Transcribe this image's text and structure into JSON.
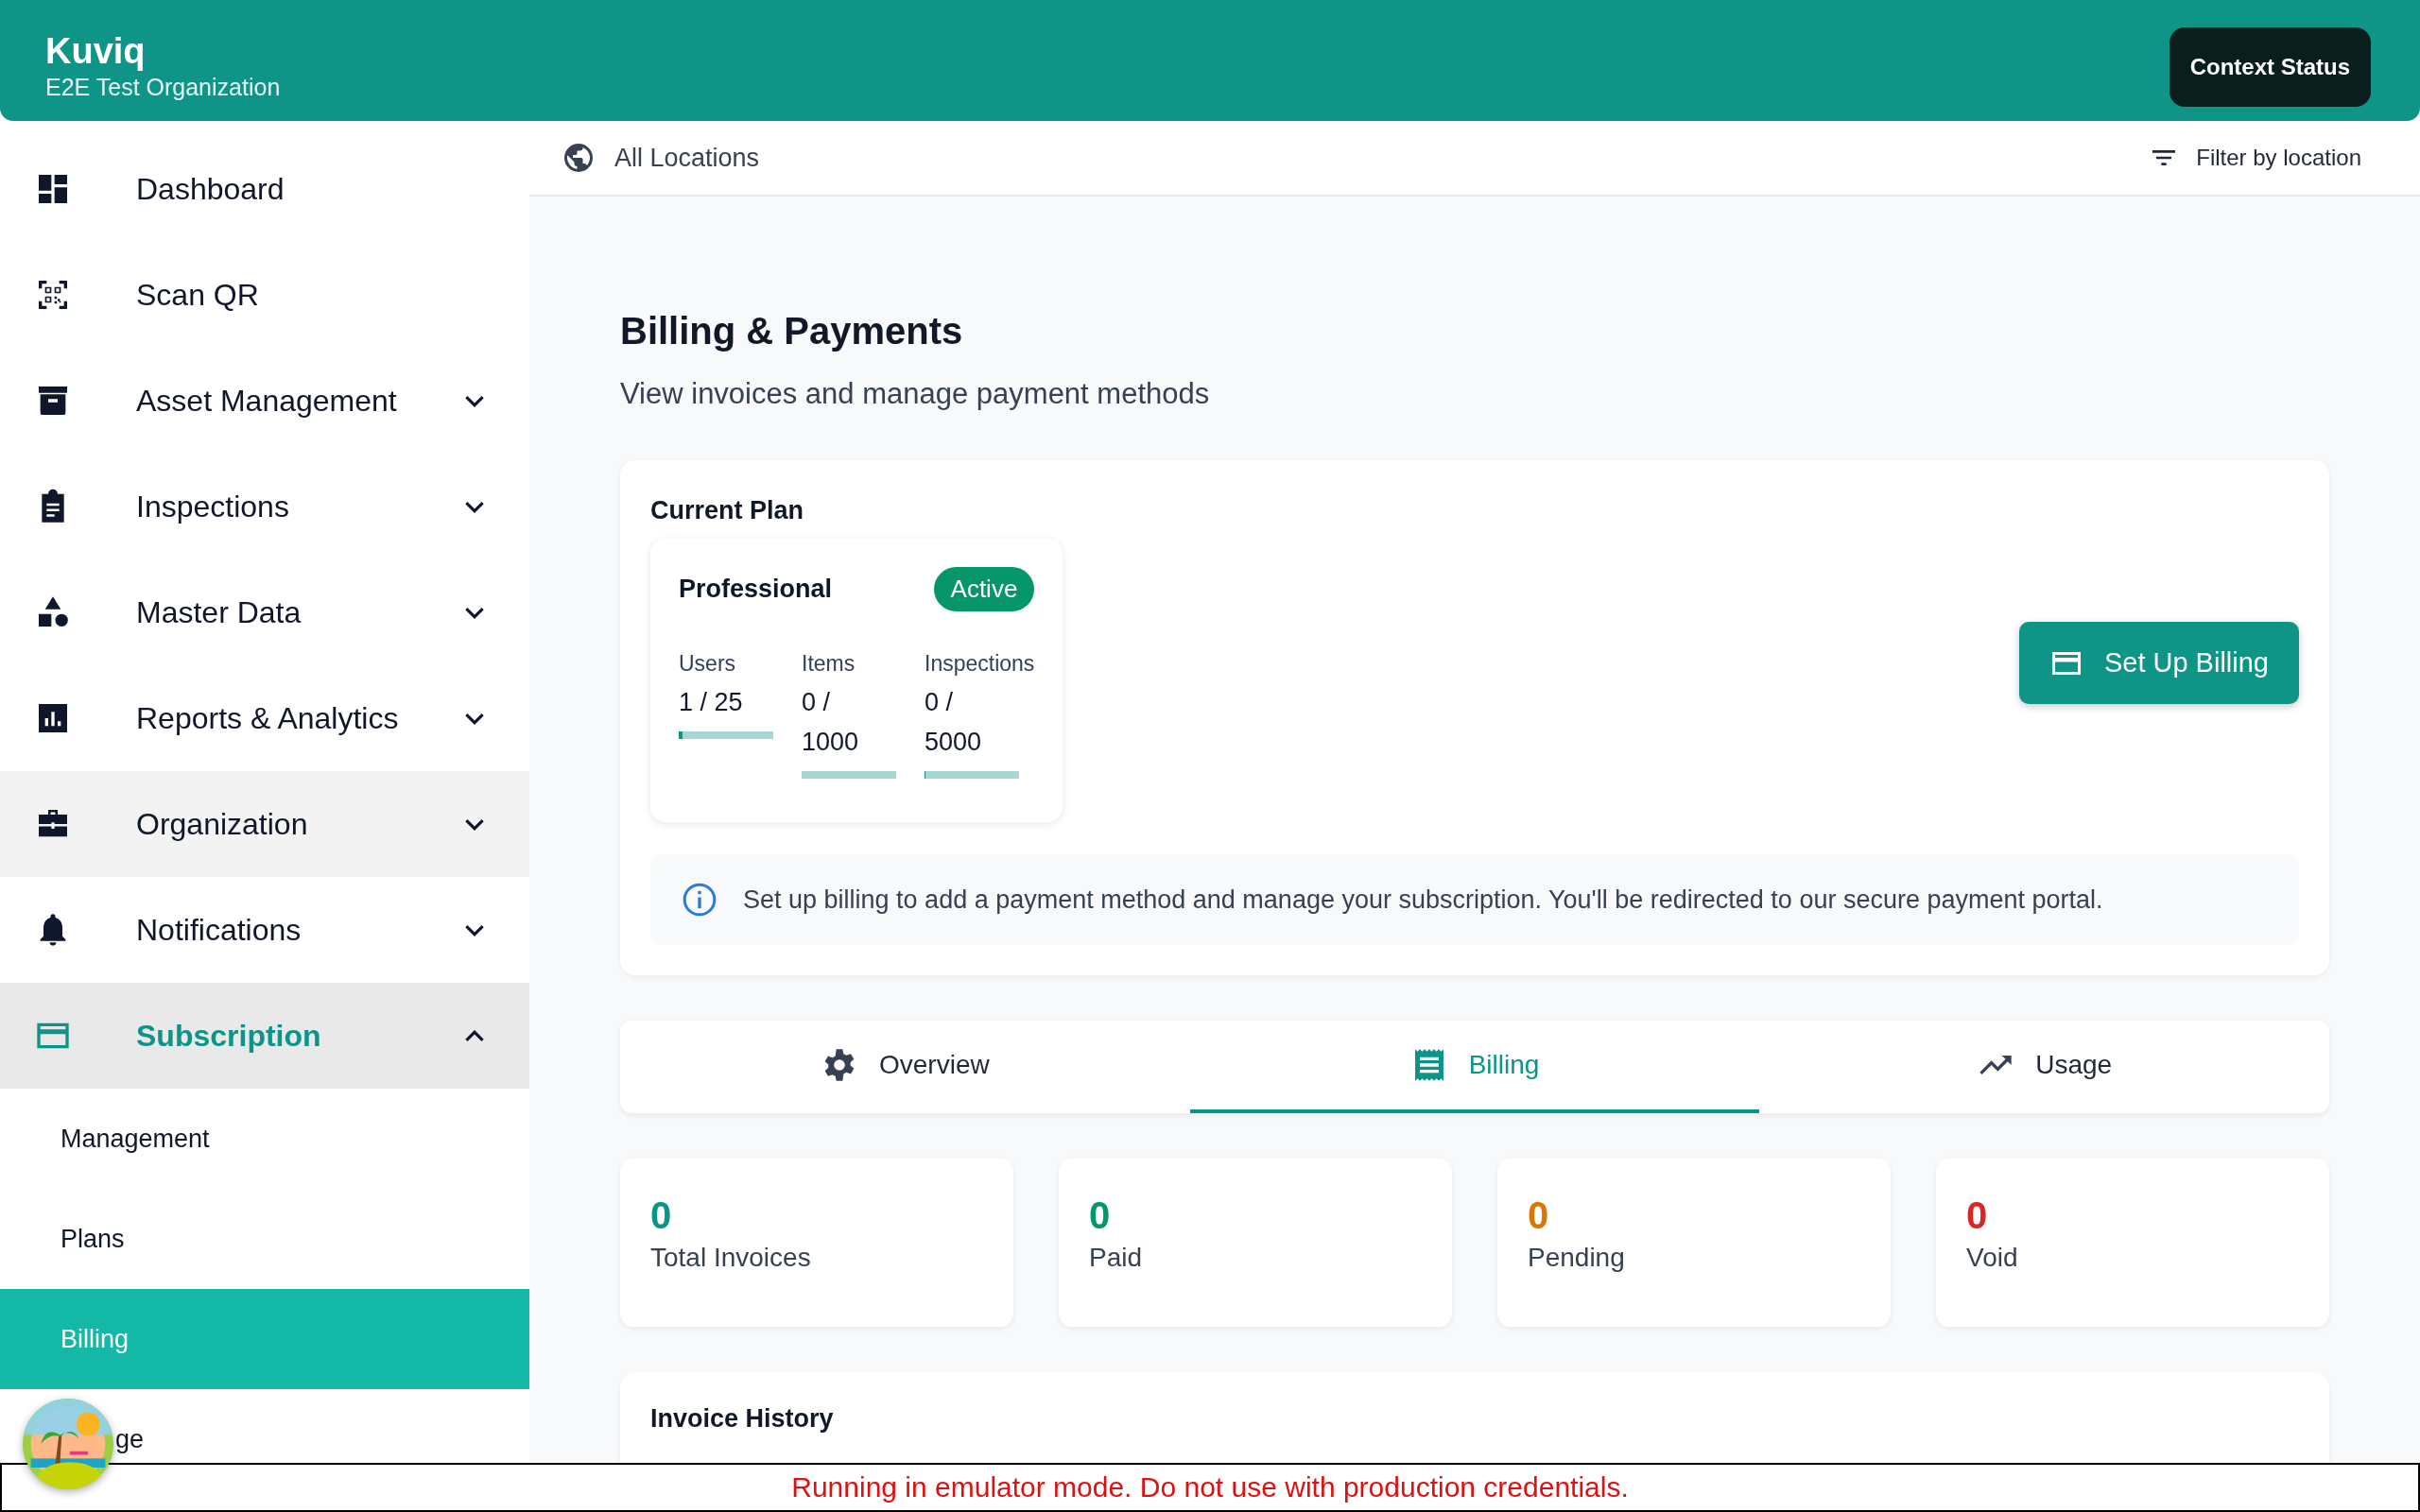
{
  "header": {
    "brand": "Kuviq",
    "organization": "E2E Test Organization",
    "status_button": "Context Status"
  },
  "sidebar": {
    "items": [
      {
        "label": "Dashboard",
        "selected": false,
        "highlighted": false
      },
      {
        "label": "Scan QR",
        "selected": false,
        "highlighted": false
      },
      {
        "label": "Asset Management",
        "expanded": false,
        "selected": false,
        "highlighted": false
      },
      {
        "label": "Inspections",
        "expanded": false,
        "selected": false,
        "highlighted": false
      },
      {
        "label": "Master Data",
        "expanded": false,
        "selected": false,
        "highlighted": false
      },
      {
        "label": "Reports & Analytics",
        "expanded": false,
        "selected": false,
        "highlighted": false
      },
      {
        "label": "Organization",
        "expanded": false,
        "selected": false,
        "highlighted": true
      },
      {
        "label": "Notifications",
        "expanded": false,
        "selected": false,
        "highlighted": false
      },
      {
        "label": "Subscription",
        "expanded": true,
        "selected": true,
        "highlighted": false,
        "children": [
          {
            "label": "Management",
            "selected": false
          },
          {
            "label": "Plans",
            "selected": false
          },
          {
            "label": "Billing",
            "selected": true
          },
          {
            "label": "ge",
            "selected": false
          }
        ]
      }
    ]
  },
  "location_bar": {
    "location": "All Locations",
    "filter": "Filter by location"
  },
  "page": {
    "title": "Billing & Payments",
    "subtitle": "View invoices and manage payment methods"
  },
  "current_plan": {
    "heading": "Current Plan",
    "plan": "Professional",
    "status": "Active",
    "setup_button": "Set Up Billing",
    "usage": [
      {
        "label": "Users",
        "value": "1 / 25",
        "level": 0.04
      },
      {
        "label": "Items",
        "value": "0 / 1000",
        "level": 0
      },
      {
        "label": "Inspections",
        "value": "0 / 5000",
        "level": 0.005
      }
    ],
    "info": "Set up billing to add a payment method and manage your subscription. You'll be redirected to our secure payment portal."
  },
  "tabs": [
    {
      "label": "Overview",
      "selected": false
    },
    {
      "label": "Billing",
      "selected": true
    },
    {
      "label": "Usage",
      "selected": false
    }
  ],
  "stats": [
    {
      "value": "0",
      "label": "Total Invoices",
      "color": "#0d9488"
    },
    {
      "value": "0",
      "label": "Paid",
      "color": "#059669"
    },
    {
      "value": "0",
      "label": "Pending",
      "color": "#d97706"
    },
    {
      "value": "0",
      "label": "Void",
      "color": "#dc2626"
    }
  ],
  "invoice_history": {
    "heading": "Invoice History"
  },
  "banner": "Running in emulator mode. Do not use with production credentials."
}
